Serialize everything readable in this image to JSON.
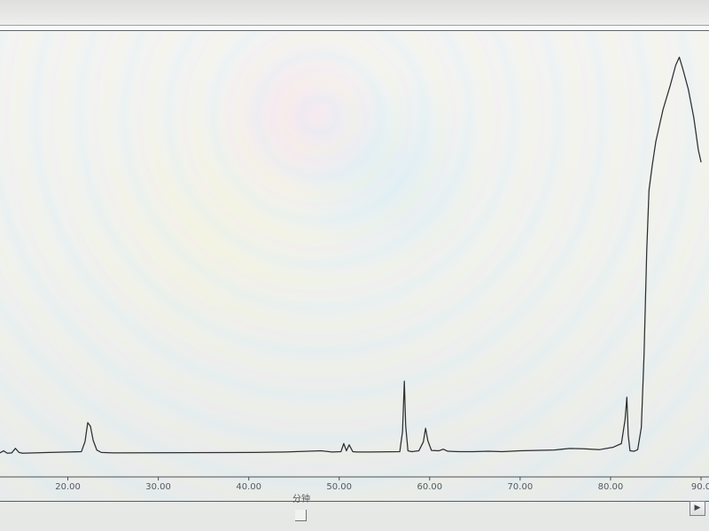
{
  "chart_data": {
    "type": "line",
    "title": "",
    "xlabel": "分钟",
    "ylabel": "",
    "xlim": [
      12.5,
      90.0
    ],
    "ylim": [
      0,
      100
    ],
    "x_ticks": [
      "20.00",
      "30.00",
      "40.00",
      "50.00",
      "60.00",
      "70.00",
      "80.00",
      "90.0"
    ],
    "grid": false,
    "series": [
      {
        "x": [
          12.5,
          12.9,
          13.3,
          13.8,
          14.2,
          14.6,
          15.0,
          18.0,
          21.5,
          21.9,
          22.2,
          22.5,
          22.8,
          23.2,
          23.7,
          25.0,
          40.5,
          44.0,
          48.0,
          49.2,
          50.2,
          50.5,
          50.8,
          51.1,
          51.5,
          52.0,
          53.5,
          56.7,
          57.0,
          57.2,
          57.35,
          57.6,
          58.0,
          58.8,
          59.3,
          59.55,
          59.8,
          60.2,
          61.0,
          61.5,
          62.0,
          63.2,
          64.8,
          66.5,
          68.0,
          70.0,
          73.8,
          75.5,
          77.0,
          78.8,
          80.3,
          81.2,
          81.6,
          81.8,
          81.95,
          82.15,
          82.6,
          83.0,
          83.4,
          83.7,
          84.0,
          84.25,
          84.6,
          85.0,
          85.8,
          86.6,
          87.2,
          87.6,
          88.0,
          88.6,
          89.2,
          89.7,
          90.0
        ],
        "y": [
          0.7,
          1.2,
          0.6,
          0.7,
          1.8,
          0.8,
          0.6,
          0.8,
          1.0,
          3.5,
          8.2,
          7.3,
          3.8,
          1.4,
          0.8,
          0.7,
          0.8,
          0.9,
          1.2,
          0.9,
          1.0,
          3.0,
          1.2,
          2.7,
          1.0,
          0.9,
          0.9,
          1.0,
          6.0,
          18.5,
          7.4,
          1.2,
          1.0,
          1.2,
          3.4,
          6.8,
          3.7,
          1.3,
          1.2,
          1.6,
          1.1,
          1.0,
          1.0,
          1.1,
          1.0,
          1.2,
          1.4,
          1.8,
          1.7,
          1.5,
          2.1,
          3.0,
          8.9,
          14.5,
          5.1,
          1.2,
          1.1,
          1.5,
          7.0,
          25.0,
          51.0,
          66.0,
          72.0,
          78.0,
          86.0,
          92.0,
          97.0,
          99.0,
          96.0,
          91.0,
          84.0,
          76.0,
          73.0
        ]
      }
    ]
  }
}
